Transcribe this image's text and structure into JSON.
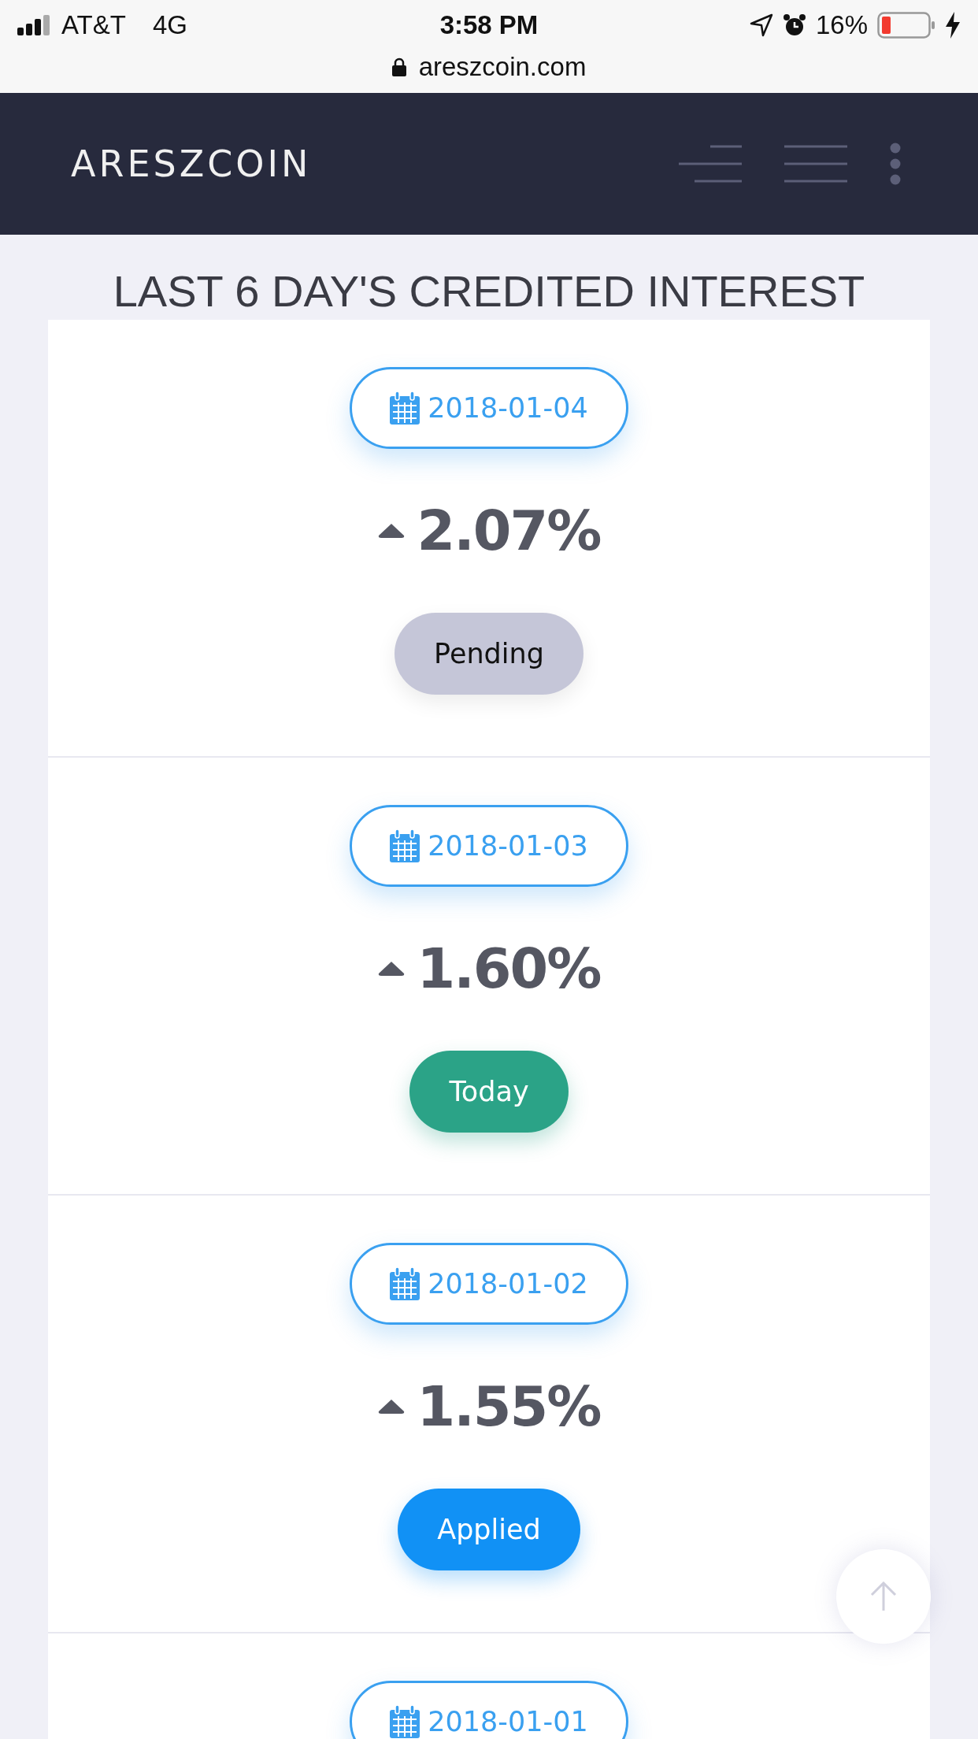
{
  "status_bar": {
    "carrier": "AT&T",
    "network": "4G",
    "time": "3:58 PM",
    "battery": "16%"
  },
  "address_bar": {
    "url": "areszcoin.com"
  },
  "navbar": {
    "brand": "ARESZCOIN"
  },
  "page_title": "LAST 6 DAY'S CREDITED INTEREST",
  "entries": [
    {
      "date": "2018-01-04",
      "rate": "2.07%",
      "status": {
        "label": "Pending",
        "kind": "pending"
      }
    },
    {
      "date": "2018-01-03",
      "rate": "1.60%",
      "status": {
        "label": "Today",
        "kind": "today"
      }
    },
    {
      "date": "2018-01-02",
      "rate": "1.55%",
      "status": {
        "label": "Applied",
        "kind": "applied"
      }
    },
    {
      "date": "2018-01-01"
    }
  ]
}
